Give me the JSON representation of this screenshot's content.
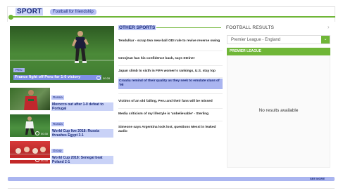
{
  "header": {
    "title": "SPORT",
    "tag": "Football for friendship"
  },
  "featured": {
    "category": "Peru",
    "title": "France fight off Peru for 1-0 victory",
    "duration": "00:28"
  },
  "stories": [
    {
      "category": "Russia",
      "title": "Morocco out after 1-0 defeat to Portugal",
      "duration": ""
    },
    {
      "category": "Russia",
      "title": "World Cup live 2018: Russia thrashes Egypt 3-1",
      "duration": "00:30"
    },
    {
      "category": "Group",
      "title": "World Cup 2018: Senegal beat Poland 2-1",
      "duration": "00:30"
    }
  ],
  "other_sports": {
    "heading": "OTHER SPORTS",
    "items": [
      "Tendulkar - scrap two new-ball ODI rule to revive reverse swing",
      "Grosjean has his confidence back, says Steiner",
      "Japan climb to sixth in FIFA women's rankings, U.S. stay top",
      "Croatia remind of their quality as they seek to emulate class of '98",
      "Victims of an old failing, Peru and their fans will be missed",
      "Media criticism of my lifestyle is 'unbelievable' - Sterling",
      "Simeone says Argentina look lost, questions Messi in leaked audio"
    ]
  },
  "football_results": {
    "heading": "FOOTBALL RESULTS",
    "league_select": "Premier League - England",
    "league_bar": "PREMIER LEAGUE",
    "empty": "No results available"
  },
  "footer": {
    "more": "SEE MORE"
  },
  "colors": {
    "accent_green": "#6fb637",
    "highlight_blue": "#aab5f0",
    "title_navy": "#1b2b7a"
  }
}
